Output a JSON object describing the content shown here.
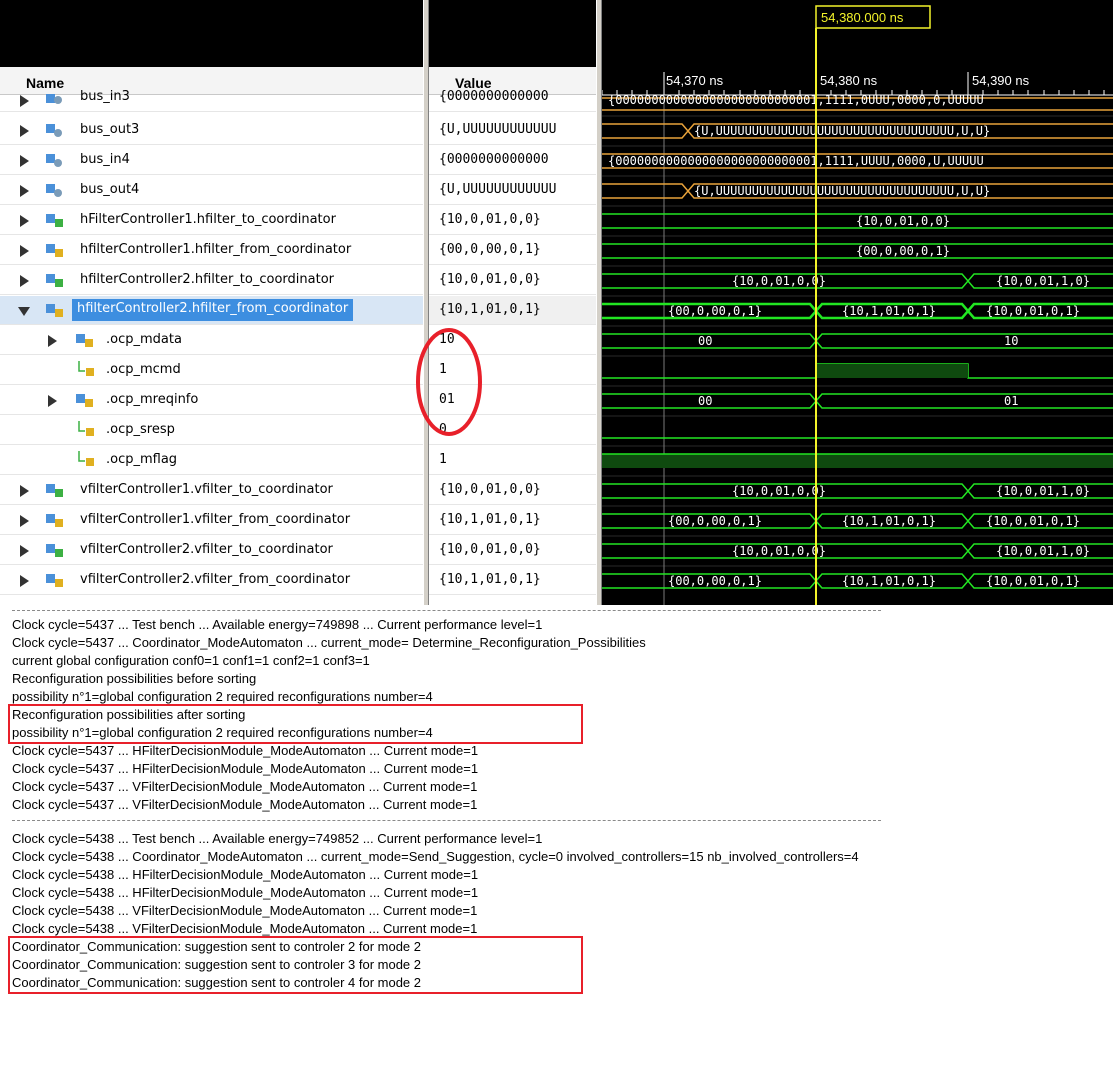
{
  "header": {
    "name_col": "Name",
    "value_col": "Value",
    "cursor_time": "54,380.000 ns",
    "ticks": [
      "54,370 ns",
      "54,380 ns",
      "54,390 ns"
    ]
  },
  "signals": [
    {
      "name": "bus_in3",
      "value": "{0000000000000",
      "wave": "{0000000000000000000000000001,1111,0UUU,0000,0,UUUUU"
    },
    {
      "name": "bus_out3",
      "value": "{U,UUUUUUUUUUUU",
      "wave": "{U,UUUUUUUUUUUUUUUUUUUUUUUUUUUUUUUUU,U,U}"
    },
    {
      "name": "bus_in4",
      "value": "{0000000000000",
      "wave": "{0000000000000000000000000001,1111,UUUU,0000,U,UUUUU"
    },
    {
      "name": "bus_out4",
      "value": "{U,UUUUUUUUUUUU",
      "wave": "{U,UUUUUUUUUUUUUUUUUUUUUUUUUUUUUUUUU,U,U}"
    },
    {
      "name": "hFilterController1.hfilter_to_coordinator",
      "value": "{10,0,01,0,0}",
      "wave": "{10,0,01,0,0}"
    },
    {
      "name": "hfilterController1.hfilter_from_coordinator",
      "value": "{00,0,00,0,1}",
      "wave": "{00,0,00,0,1}"
    },
    {
      "name": "hfilterController2.hfilter_to_coordinator",
      "value": "{10,0,01,0,0}",
      "wave_a": "{10,0,01,0,0}",
      "wave_b": "{10,0,01,1,0}"
    },
    {
      "name": "hfilterController2.hfilter_from_coordinator",
      "value": "{10,1,01,0,1}",
      "wave_a": "{00,0,00,0,1}",
      "wave_b": "{10,1,01,0,1}",
      "wave_c": "{10,0,01,0,1}"
    },
    {
      "name": ".ocp_mdata",
      "value": "10",
      "wave_a": "00",
      "wave_b": "10"
    },
    {
      "name": ".ocp_mcmd",
      "value": "1"
    },
    {
      "name": ".ocp_mreqinfo",
      "value": "01",
      "wave_a": "00",
      "wave_b": "01"
    },
    {
      "name": ".ocp_sresp",
      "value": "0"
    },
    {
      "name": ".ocp_mflag",
      "value": "1"
    },
    {
      "name": "vfilterController1.vfilter_to_coordinator",
      "value": "{10,0,01,0,0}",
      "wave_a": "{10,0,01,0,0}",
      "wave_b": "{10,0,01,1,0}"
    },
    {
      "name": "vfilterController1.vfilter_from_coordinator",
      "value": "{10,1,01,0,1}",
      "wave_a": "{00,0,00,0,1}",
      "wave_b": "{10,1,01,0,1}",
      "wave_c": "{10,0,01,0,1}"
    },
    {
      "name": "vfilterController2.vfilter_to_coordinator",
      "value": "{10,0,01,0,0}",
      "wave_a": "{10,0,01,0,0}",
      "wave_b": "{10,0,01,1,0}"
    },
    {
      "name": "vfilterController2.vfilter_from_coordinator",
      "value": "{10,1,01,0,1}",
      "wave_a": "{00,0,00,0,1}",
      "wave_b": "{10,1,01,0,1}",
      "wave_c": "{10,0,01,0,1}"
    }
  ],
  "log": {
    "block1": [
      "Clock cycle=5437 ... Test bench ... Available energy=749898 ... Current performance level=1",
      "Clock cycle=5437 ... Coordinator_ModeAutomaton ... current_mode= Determine_Reconfiguration_Possibilities",
      "current global configuration  conf0=1  conf1=1  conf2=1  conf3=1",
      "Reconfiguration possibilities before sorting",
      "possibility n°1=global configuration 2 required reconfigurations number=4",
      "Reconfiguration possibilities after sorting",
      "possibility n°1=global configuration 2 required reconfigurations number=4",
      "Clock cycle=5437 ... HFilterDecisionModule_ModeAutomaton ... Current mode=1",
      "Clock cycle=5437 ... HFilterDecisionModule_ModeAutomaton ... Current mode=1",
      "Clock cycle=5437 ... VFilterDecisionModule_ModeAutomaton ... Current mode=1",
      "Clock cycle=5437 ... VFilterDecisionModule_ModeAutomaton ... Current mode=1"
    ],
    "block2": [
      "Clock cycle=5438 ... Test bench ... Available energy=749852 ... Current performance level=1",
      "Clock cycle=5438 ... Coordinator_ModeAutomaton ... current_mode=Send_Suggestion, cycle=0  involved_controllers=15  nb_involved_controllers=4",
      "Clock cycle=5438 ... HFilterDecisionModule_ModeAutomaton ... Current mode=1",
      "Clock cycle=5438 ... HFilterDecisionModule_ModeAutomaton ... Current mode=1",
      "Clock cycle=5438 ... VFilterDecisionModule_ModeAutomaton ... Current mode=1",
      "Clock cycle=5438 ... VFilterDecisionModule_ModeAutomaton ... Current mode=1",
      "Coordinator_Communication: suggestion sent to controler 2 for mode 2",
      "Coordinator_Communication: suggestion sent to controler 3 for mode 2",
      "Coordinator_Communication: suggestion sent to controler 4 for mode 2"
    ]
  },
  "colors": {
    "wave": "#22e622",
    "bus_wave": "#e8a23a",
    "cursor": "#f3f32a",
    "highlight": "#e8202a",
    "selected_name": "#3d8ee0"
  }
}
